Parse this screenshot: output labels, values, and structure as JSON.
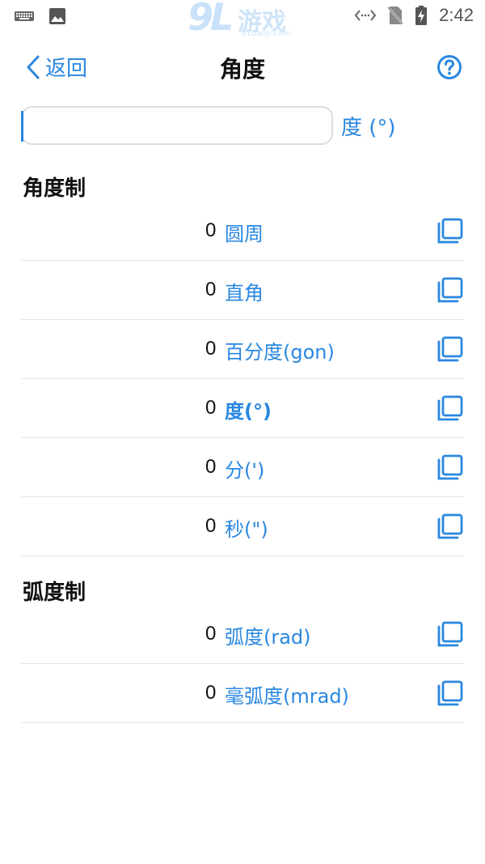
{
  "status_bar": {
    "time": "2:42",
    "watermark_number": "9L",
    "watermark_text": "游戏",
    "watermark_url": "91danji.com"
  },
  "nav": {
    "back_label": "返回",
    "title": "角度"
  },
  "input": {
    "value": "",
    "unit": "度 (°)"
  },
  "sections": [
    {
      "title": "角度制",
      "rows": [
        {
          "value": "0",
          "unit": "圆周",
          "selected": false
        },
        {
          "value": "0",
          "unit": "直角",
          "selected": false
        },
        {
          "value": "0",
          "unit": "百分度(gon)",
          "selected": false
        },
        {
          "value": "0",
          "unit": "度(°)",
          "selected": true
        },
        {
          "value": "0",
          "unit": "分(')",
          "selected": false
        },
        {
          "value": "0",
          "unit": "秒(\")",
          "selected": false
        }
      ]
    },
    {
      "title": "弧度制",
      "rows": [
        {
          "value": "0",
          "unit": "弧度(rad)",
          "selected": false
        },
        {
          "value": "0",
          "unit": "毫弧度(mrad)",
          "selected": false
        }
      ]
    }
  ],
  "colors": {
    "accent": "#2a87e0",
    "divider": "#e6e6e6",
    "text": "#111111"
  }
}
